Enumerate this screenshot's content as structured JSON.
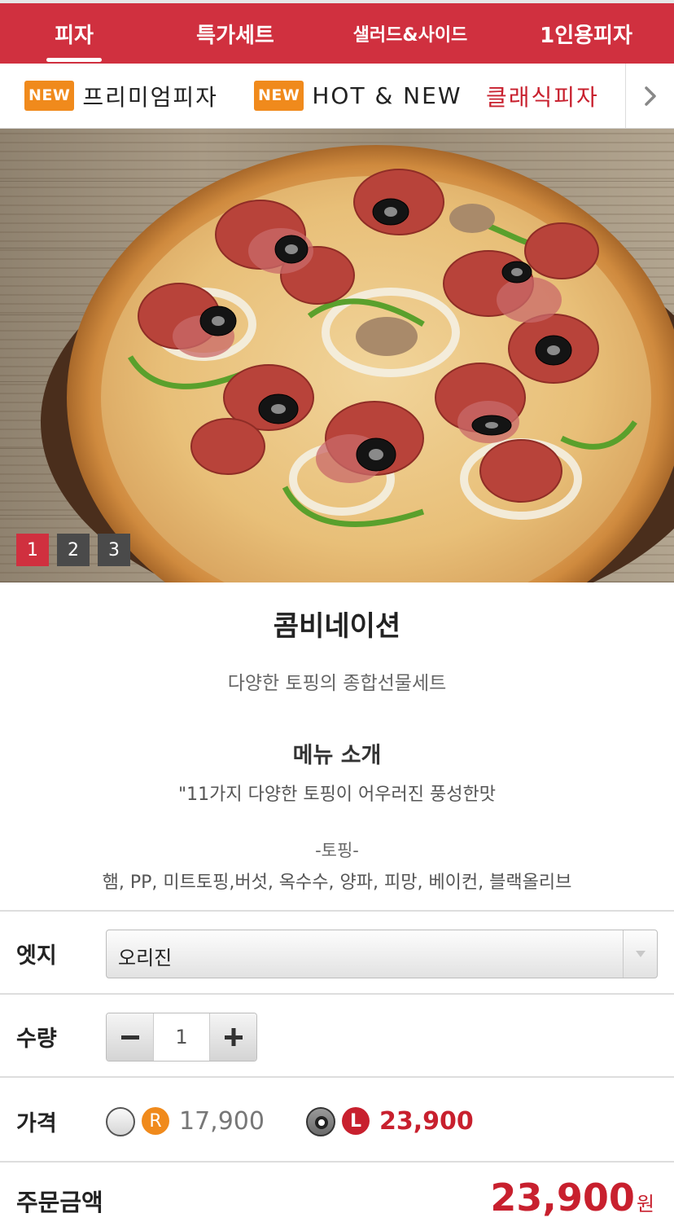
{
  "top_tabs": [
    "피자",
    "특가세트",
    "샐러드&사이드",
    "1인용피자"
  ],
  "sub_categories": [
    {
      "badge": "NEW",
      "label": "프리미엄피자"
    },
    {
      "badge": "NEW",
      "label": "HOT & NEW"
    },
    {
      "badge": "",
      "label": "클래식피자"
    }
  ],
  "pager": [
    "1",
    "2",
    "3"
  ],
  "product": {
    "name": "콤비네이션",
    "description": "다양한 토핑의 종합선물세트",
    "intro_heading": "메뉴 소개",
    "intro_text": "\"11가지 다양한 토핑이 어우러진 풍성한맛",
    "toppings_heading": "-토핑-",
    "toppings": "햄, PP, 미트토핑,버섯, 옥수수, 양파, 피망, 베이컨, 블랙올리브"
  },
  "options": {
    "edge_label": "엣지",
    "edge_value": "오리진",
    "qty_label": "수량",
    "qty_value": "1",
    "price_label": "가격",
    "regular_badge": "R",
    "regular_price": "17,900",
    "large_badge": "L",
    "large_price": "23,900",
    "selected_size": "L"
  },
  "total": {
    "label": "주문금액",
    "amount": "23,900",
    "unit": "원"
  },
  "colors": {
    "brand_red": "#d0303f",
    "new_badge": "#f08a1c",
    "price_red": "#c8202e"
  }
}
